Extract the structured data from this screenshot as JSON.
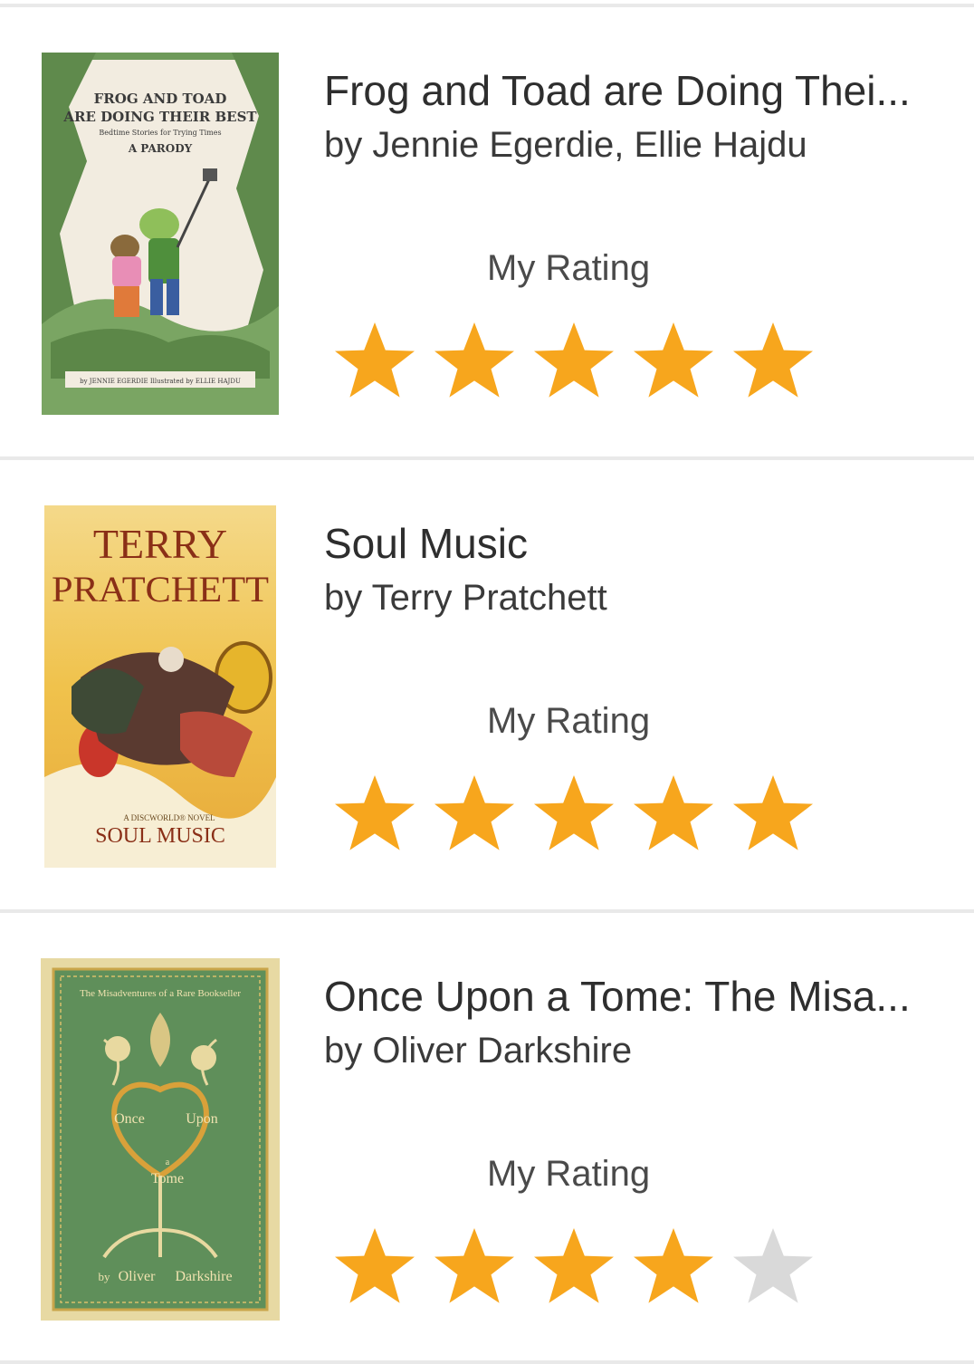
{
  "colors": {
    "star_on": "#f7a61d",
    "star_off": "#d9d9d9"
  },
  "books": [
    {
      "title": "Frog and Toad are Doing Thei...",
      "author": "by Jennie Egerdie, Ellie Hajdu",
      "rating_label": "My Rating",
      "rating": 5,
      "cover": {
        "line1": "FROG AND TOAD",
        "line2": "ARE DOING THEIR BEST",
        "line3": "Bedtime Stories for Trying Times",
        "line4": "A PARODY",
        "credit": "by JENNIE EGERDIE  Illustrated by  ELLIE HAJDU"
      }
    },
    {
      "title": "Soul Music",
      "author": "by Terry Pratchett",
      "rating_label": "My Rating",
      "rating": 5,
      "cover": {
        "line1": "TERRY",
        "line2": "PRATCHETT",
        "line3": "A DISCWORLD® NOVEL",
        "line4": "SOUL MUSIC"
      }
    },
    {
      "title": "Once Upon a Tome: The Misa...",
      "author": "by Oliver Darkshire",
      "rating_label": "My Rating",
      "rating": 4,
      "cover": {
        "line1": "The Misadventures of a Rare Bookseller",
        "line2": "Once",
        "line3": "Upon",
        "line4": "a",
        "line5": "Tome",
        "line6": "by",
        "line7": "Oliver",
        "line8": "Darkshire"
      }
    }
  ]
}
